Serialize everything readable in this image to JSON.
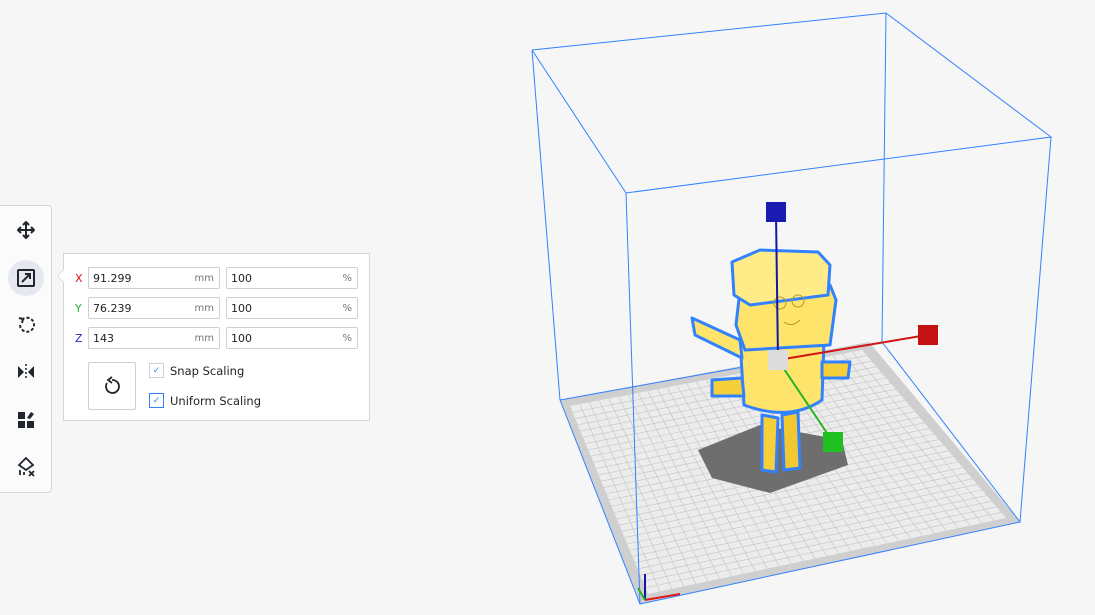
{
  "tools": [
    {
      "name": "move-tool",
      "icon": "move-icon",
      "active": false
    },
    {
      "name": "scale-tool",
      "icon": "scale-icon",
      "active": true
    },
    {
      "name": "rotate-tool",
      "icon": "rotate-icon",
      "active": false
    },
    {
      "name": "mirror-tool",
      "icon": "mirror-icon",
      "active": false
    },
    {
      "name": "per-model-settings-tool",
      "icon": "per-model-settings-icon",
      "active": false
    },
    {
      "name": "support-blocker-tool",
      "icon": "support-blocker-icon",
      "active": false
    }
  ],
  "scale_panel": {
    "rows": [
      {
        "axis": "X",
        "mm": "91.299",
        "mm_unit": "mm",
        "percent": "100",
        "percent_unit": "%",
        "color": "#e01818"
      },
      {
        "axis": "Y",
        "mm": "76.239",
        "mm_unit": "mm",
        "percent": "100",
        "percent_unit": "%",
        "color": "#2db52d"
      },
      {
        "axis": "Z",
        "mm": "143",
        "mm_unit": "mm",
        "percent": "100",
        "percent_unit": "%",
        "color": "#2727c8"
      }
    ],
    "reset_icon": "reset-icon",
    "snap_scaling": {
      "label": "Snap Scaling",
      "checked": true
    },
    "uniform_scaling": {
      "label": "Uniform Scaling",
      "checked": true
    }
  },
  "colors": {
    "accent": "#3282ff",
    "model": "#ffe46c",
    "x_axis": "#e01818",
    "y_axis": "#2db52d",
    "z_axis": "#1515a8"
  }
}
